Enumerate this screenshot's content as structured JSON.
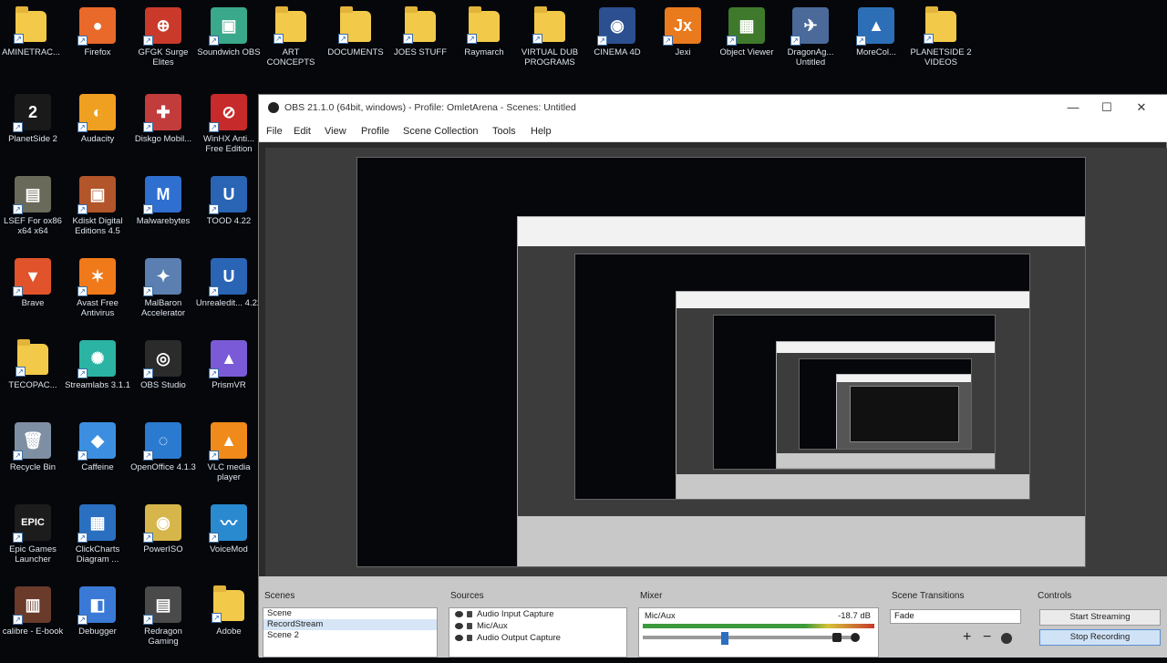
{
  "desktop": {
    "icons": [
      {
        "label": "AMINETRAC...",
        "icon": "folder-icon",
        "kind": "folder"
      },
      {
        "label": "Firefox",
        "icon": "firefox-icon",
        "kind": "app",
        "color": "#e8692a",
        "glyph": "●"
      },
      {
        "label": "GFGK Surge Elites",
        "icon": "target-icon",
        "kind": "app",
        "color": "#c93a2a",
        "glyph": "⊕"
      },
      {
        "label": "Soundwich OBS",
        "icon": "obs-green-icon",
        "kind": "app",
        "color": "#3aa88a",
        "glyph": "▣"
      },
      {
        "label": "ART CONCEPTS",
        "icon": "folder-icon",
        "kind": "folder"
      },
      {
        "label": "DOCUMENTS",
        "icon": "folder-icon",
        "kind": "folder"
      },
      {
        "label": "JOES STUFF",
        "icon": "folder-icon",
        "kind": "folder"
      },
      {
        "label": "Raymarch",
        "icon": "folder-icon",
        "kind": "folder"
      },
      {
        "label": "VIRTUAL DUB PROGRAMS",
        "icon": "folder-icon",
        "kind": "folder"
      },
      {
        "label": "CINEMA 4D",
        "icon": "cinema4d-icon",
        "kind": "app",
        "color": "#2c4f8f",
        "glyph": "◉"
      },
      {
        "label": "Jexi",
        "icon": "jx-icon",
        "kind": "app",
        "color": "#e97a1e",
        "glyph": "Jx"
      },
      {
        "label": "Object Viewer",
        "icon": "object-viewer-icon",
        "kind": "app",
        "color": "#3f7a2c",
        "glyph": "▦"
      },
      {
        "label": "DragonAg... Untitled",
        "icon": "dragon-icon",
        "kind": "app",
        "color": "#4b6a9a",
        "glyph": "✈"
      },
      {
        "label": "MoreCol...",
        "icon": "mountain-icon",
        "kind": "app",
        "color": "#2d6fb7",
        "glyph": "▲"
      },
      {
        "label": "PLANETSIDE 2 VIDEOS",
        "icon": "folder-icon",
        "kind": "folder"
      },
      {
        "label": "PlanetSide 2",
        "icon": "planetside-icon",
        "kind": "app",
        "color": "#1a1a1a",
        "glyph": "2"
      },
      {
        "label": "Audacity",
        "icon": "audacity-icon",
        "kind": "app",
        "color": "#f0a020",
        "glyph": "◐"
      },
      {
        "label": "Diskgo Mobil...",
        "icon": "diskgo-icon",
        "kind": "app",
        "color": "#c23c3c",
        "glyph": "✚"
      },
      {
        "label": "WinHX Anti... Free Edition",
        "icon": "no-entry-icon",
        "kind": "app",
        "color": "#c62a2a",
        "glyph": "⊘"
      },
      {
        "label": "LSEF For ox86 x64 x64",
        "icon": "lsef-icon",
        "kind": "app",
        "color": "#6a6a5a",
        "glyph": "▤"
      },
      {
        "label": "Kdiskt Digital Editions 4.5",
        "icon": "kdiskt-icon",
        "kind": "app",
        "color": "#b2552a",
        "glyph": "▣"
      },
      {
        "label": "Malwarebytes",
        "icon": "malwarebytes-icon",
        "kind": "app",
        "color": "#2f6fd0",
        "glyph": "M"
      },
      {
        "label": "TOOD 4.22",
        "icon": "unreal-icon",
        "kind": "app",
        "color": "#2a64b5",
        "glyph": "U"
      },
      {
        "label": "Brave",
        "icon": "brave-icon",
        "kind": "app",
        "color": "#e0532b",
        "glyph": "▼"
      },
      {
        "label": "Avast Free Antivirus",
        "icon": "avast-icon",
        "kind": "app",
        "color": "#f07a1a",
        "glyph": "✶"
      },
      {
        "label": "MalBaron Accelerator",
        "icon": "tools-icon",
        "kind": "app",
        "color": "#5a7fb0",
        "glyph": "✦"
      },
      {
        "label": "Unrealedit... 4.22",
        "icon": "unreal-icon",
        "kind": "app",
        "color": "#2a64b5",
        "glyph": "U"
      },
      {
        "label": "TECOPAC...",
        "icon": "folder-icon",
        "kind": "folder"
      },
      {
        "label": "Streamlabs 3.1.1",
        "icon": "streamlabs-icon",
        "kind": "app",
        "color": "#2bb3a3",
        "glyph": "✺"
      },
      {
        "label": "OBS Studio",
        "icon": "obs-icon",
        "kind": "app",
        "color": "#2b2b2b",
        "glyph": "◎"
      },
      {
        "label": "PrismVR",
        "icon": "prism-icon",
        "kind": "app",
        "color": "#7a5ad6",
        "glyph": "▲"
      },
      {
        "label": "Recycle Bin",
        "icon": "recycle-bin-icon",
        "kind": "app",
        "color": "#7f8fa3",
        "glyph": "🗑"
      },
      {
        "label": "Caffeine",
        "icon": "caffeine-icon",
        "kind": "app",
        "color": "#3c8fe0",
        "glyph": "◆"
      },
      {
        "label": "OpenOffice 4.1.3",
        "icon": "openoffice-icon",
        "kind": "app",
        "color": "#2a7ad0",
        "glyph": "◌"
      },
      {
        "label": "VLC media player",
        "icon": "vlc-icon",
        "kind": "app",
        "color": "#f08a1a",
        "glyph": "▲"
      },
      {
        "label": "Epic Games Launcher",
        "icon": "epic-icon",
        "kind": "app",
        "color": "#1c1c1c",
        "glyph": "EPIC"
      },
      {
        "label": "ClickCharts Diagram ...",
        "icon": "clickcharts-icon",
        "kind": "app",
        "color": "#2a6fc0",
        "glyph": "▦"
      },
      {
        "label": "PowerISO",
        "icon": "poweriso-icon",
        "kind": "app",
        "color": "#d6b64a",
        "glyph": "◉"
      },
      {
        "label": "VoiceMod",
        "icon": "voicemod-icon",
        "kind": "app",
        "color": "#2a8ad0",
        "glyph": "〰"
      },
      {
        "label": "calibre - E-book",
        "icon": "calibre-icon",
        "kind": "app",
        "color": "#6a3a2a",
        "glyph": "▥"
      },
      {
        "label": "Debugger",
        "icon": "debugger-icon",
        "kind": "app",
        "color": "#3a7ad6",
        "glyph": "◧"
      },
      {
        "label": "Redragon Gaming",
        "icon": "redragon-icon",
        "kind": "app",
        "color": "#4a4a4a",
        "glyph": "▤"
      },
      {
        "label": "Adobe",
        "icon": "folder-icon",
        "kind": "folder"
      }
    ]
  },
  "obs": {
    "title": "OBS 21.1.0 (64bit, windows) - Profile: OmletArena - Scenes: Untitled",
    "window_buttons": {
      "minimize": "—",
      "maximize": "☐",
      "close": "✕"
    },
    "menu": [
      "File",
      "Edit",
      "View",
      "Profile",
      "Scene Collection",
      "Tools",
      "Help"
    ],
    "docks": {
      "scenes": {
        "header": "Scenes",
        "items": [
          "Scene",
          "RecordStream",
          "Scene 2"
        ],
        "selected": 1
      },
      "sources": {
        "header": "Sources",
        "items": [
          "Audio Input Capture",
          "Mic/Aux",
          "Audio Output Capture"
        ]
      },
      "mixer": {
        "header": "Mixer",
        "track": "Mic/Aux",
        "db": "-18.7 dB"
      },
      "transitions": {
        "header": "Scene Transitions",
        "type": "Fade",
        "plus": "+",
        "minus": "−"
      },
      "controls": {
        "header": "Controls",
        "buttons": [
          "Start Streaming",
          "Stop Recording"
        ],
        "active": 1
      }
    }
  }
}
